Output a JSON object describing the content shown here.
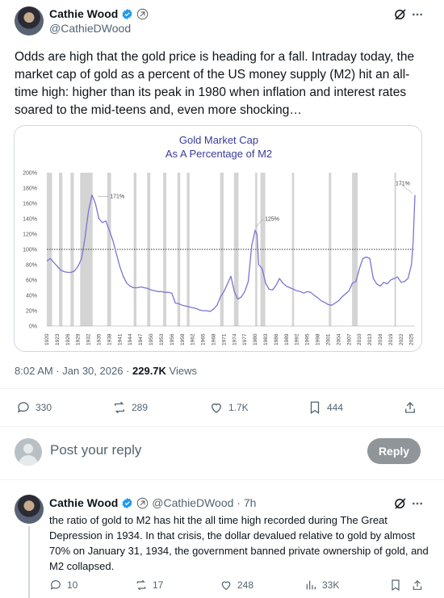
{
  "tweet": {
    "author_name": "Cathie Wood",
    "author_handle": "@CathieDWood",
    "text": "Odds are high that the gold price is heading for a fall. Intraday today, the market cap of gold as a percent of the US money supply (M2) hit an all-time high: higher than its peak in 1980 when inflation and interest rates soared to the mid-teens and, even more shocking…",
    "time": "8:02 AM · Jan 30, 2026 ·",
    "views_count": "229.7K",
    "views_label": "Views",
    "replies": "330",
    "reposts": "289",
    "likes": "1.7K",
    "bookmarks": "444"
  },
  "compose": {
    "placeholder": "Post your reply",
    "button_label": "Reply"
  },
  "reply": {
    "author_name": "Cathie Wood",
    "author_handle": "@CathieDWood · 7h",
    "text": "the ratio of gold to M2 has hit the all time high recorded during The Great Depression in 1934. In that crisis, the dollar devalued relative to gold by almost 70% on January 31, 1934, the government banned private ownership of gold, and M2 collapsed.",
    "replies": "10",
    "reposts": "17",
    "likes": "248",
    "views": "33K"
  },
  "colors": {
    "line": "#7b74d4",
    "band": "#d4d4d4",
    "title": "#3a3a9a"
  },
  "chart_data": {
    "type": "line",
    "title": "Gold Market Cap",
    "subtitle": "As A Percentage of M2",
    "ylim": [
      0,
      200
    ],
    "yticks": [
      "0%",
      "20%",
      "40%",
      "60%",
      "80%",
      "100%",
      "120%",
      "140%",
      "160%",
      "180%",
      "200%"
    ],
    "xlim": [
      1920,
      2026
    ],
    "xticks": [
      "1920",
      "1923",
      "1926",
      "1929",
      "1932",
      "1935",
      "1938",
      "1941",
      "1944",
      "1947",
      "1950",
      "1953",
      "1956",
      "1959",
      "1962",
      "1965",
      "1968",
      "1971",
      "1974",
      "1977",
      "1980",
      "1983",
      "1986",
      "1989",
      "1992",
      "1995",
      "1998",
      "2001",
      "2004",
      "2007",
      "2010",
      "2013",
      "2016",
      "2019",
      "2022",
      "2025"
    ],
    "reference_line": 100,
    "recession_bands": [
      [
        1920,
        1921.5
      ],
      [
        1923.5,
        1924.5
      ],
      [
        1926.8,
        1927.8
      ],
      [
        1929.6,
        1933.2
      ],
      [
        1937.4,
        1938.5
      ],
      [
        1945,
        1945.8
      ],
      [
        1948.9,
        1949.8
      ],
      [
        1953.5,
        1954.4
      ],
      [
        1957.6,
        1958.4
      ],
      [
        1960.3,
        1961.1
      ],
      [
        1969.9,
        1970.9
      ],
      [
        1973.9,
        1975.2
      ],
      [
        1980,
        1980.6
      ],
      [
        1981.5,
        1982.9
      ],
      [
        1990.6,
        1991.2
      ],
      [
        2001.2,
        2001.9
      ],
      [
        2007.9,
        2009.5
      ],
      [
        2020.1,
        2020.5
      ]
    ],
    "series": [
      {
        "x": [
          1920,
          1921,
          1922,
          1923,
          1924,
          1925,
          1926,
          1927,
          1928,
          1929,
          1930,
          1931,
          1932,
          1933,
          1934,
          1935,
          1936,
          1937,
          1938,
          1939,
          1940,
          1941,
          1942,
          1943,
          1944,
          1945,
          1946,
          1947,
          1948,
          1949,
          1950,
          1951,
          1952,
          1953,
          1954,
          1955,
          1956,
          1957,
          1958,
          1959,
          1960,
          1961,
          1962,
          1963,
          1964,
          1965,
          1966,
          1967,
          1968,
          1969,
          1970,
          1971,
          1972,
          1973,
          1974,
          1975,
          1976,
          1977,
          1978,
          1979,
          1980,
          1980.5,
          1981,
          1982,
          1983,
          1984,
          1985,
          1986,
          1987,
          1988,
          1989,
          1990,
          1991,
          1992,
          1993,
          1994,
          1995,
          1996,
          1997,
          1998,
          1999,
          2000,
          2001,
          2002,
          2003,
          2004,
          2005,
          2006,
          2007,
          2008,
          2009,
          2010,
          2011,
          2012,
          2013,
          2014,
          2015,
          2016,
          2017,
          2018,
          2019,
          2020,
          2021,
          2022,
          2023,
          2024,
          2025,
          2025.5,
          2026
        ],
        "y": [
          85,
          88,
          83,
          78,
          73,
          71,
          70,
          70,
          72,
          78,
          88,
          115,
          150,
          171,
          160,
          140,
          135,
          137,
          125,
          112,
          95,
          78,
          65,
          56,
          52,
          50,
          50,
          51,
          50,
          49,
          47,
          46,
          45,
          45,
          44,
          44,
          43,
          30,
          29,
          27,
          26,
          25,
          24,
          23,
          21,
          20,
          20,
          19,
          22,
          27,
          38,
          45,
          55,
          65,
          45,
          35,
          38,
          45,
          58,
          105,
          125,
          120,
          80,
          75,
          56,
          48,
          47,
          53,
          62,
          56,
          52,
          50,
          48,
          46,
          45,
          43,
          45,
          44,
          40,
          37,
          33,
          31,
          28,
          27,
          30,
          33,
          38,
          42,
          46,
          56,
          58,
          75,
          88,
          90,
          88,
          62,
          55,
          52,
          57,
          55,
          60,
          62,
          64,
          57,
          58,
          62,
          80,
          110,
          171
        ]
      }
    ],
    "annotations": [
      {
        "text": "171%",
        "x": 1934,
        "y": 171
      },
      {
        "text": "125%",
        "x": 1980,
        "y": 125
      },
      {
        "text": "171%",
        "x": 2026,
        "y": 171
      }
    ]
  }
}
